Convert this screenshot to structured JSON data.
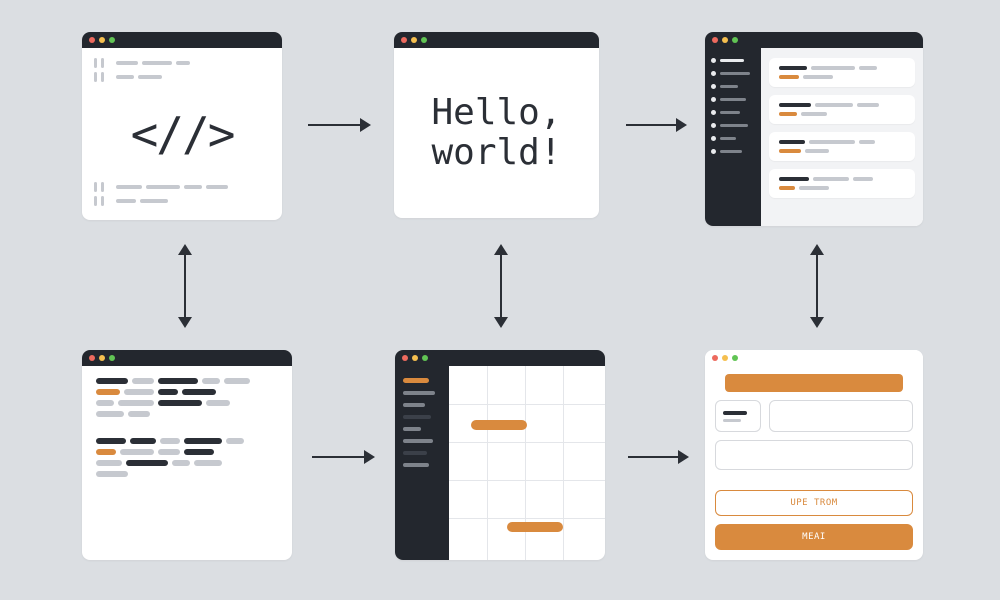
{
  "colors": {
    "accent": "#d98a3e",
    "dark": "#23272e",
    "bg": "#dbdee2"
  },
  "window1": {
    "glyph": "<//>"
  },
  "window2": {
    "text": "Hello,\nworld!"
  },
  "window6": {
    "button_outline_label": "UPE TROM",
    "button_fill_label": "MEAI"
  }
}
